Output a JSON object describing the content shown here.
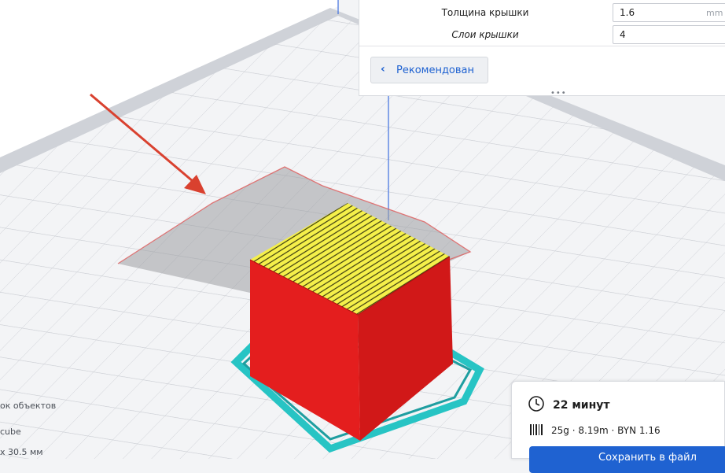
{
  "settings_panel": {
    "rows": [
      {
        "label": "Толщина крышки",
        "value": "1.6",
        "unit": "mm"
      },
      {
        "label": "Слои крышки",
        "value": "4",
        "unit": ""
      }
    ],
    "back_button_label": "Рекомендован",
    "handle": "•••"
  },
  "object_list": {
    "title": "ок объектов",
    "item": "cube",
    "dimensions": "x 30.5 мм"
  },
  "print_summary": {
    "time": "22 минут",
    "stats": "25g · 8.19m · BYN 1.16",
    "save_label": "Сохранить в файл"
  },
  "colors": {
    "accent": "#1f62d1",
    "cube_walls": "#e41e1e",
    "cube_top": "#f5f04a",
    "brim": "#27c4c4",
    "arrow": "#d9412f"
  }
}
